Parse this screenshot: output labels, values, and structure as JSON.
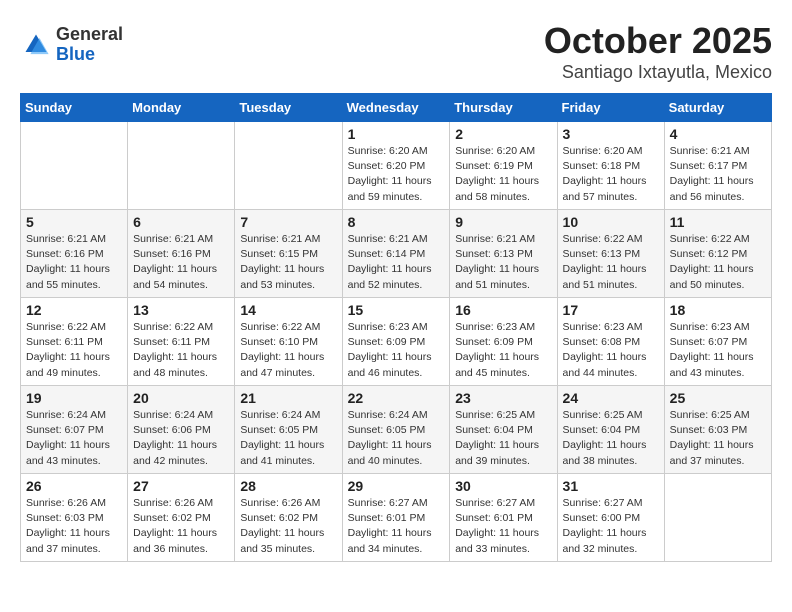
{
  "header": {
    "logo_general": "General",
    "logo_blue": "Blue",
    "month_title": "October 2025",
    "location": "Santiago Ixtayutla, Mexico"
  },
  "days_of_week": [
    "Sunday",
    "Monday",
    "Tuesday",
    "Wednesday",
    "Thursday",
    "Friday",
    "Saturday"
  ],
  "weeks": [
    [
      {
        "day": "",
        "info": ""
      },
      {
        "day": "",
        "info": ""
      },
      {
        "day": "",
        "info": ""
      },
      {
        "day": "1",
        "info": "Sunrise: 6:20 AM\nSunset: 6:20 PM\nDaylight: 11 hours and 59 minutes."
      },
      {
        "day": "2",
        "info": "Sunrise: 6:20 AM\nSunset: 6:19 PM\nDaylight: 11 hours and 58 minutes."
      },
      {
        "day": "3",
        "info": "Sunrise: 6:20 AM\nSunset: 6:18 PM\nDaylight: 11 hours and 57 minutes."
      },
      {
        "day": "4",
        "info": "Sunrise: 6:21 AM\nSunset: 6:17 PM\nDaylight: 11 hours and 56 minutes."
      }
    ],
    [
      {
        "day": "5",
        "info": "Sunrise: 6:21 AM\nSunset: 6:16 PM\nDaylight: 11 hours and 55 minutes."
      },
      {
        "day": "6",
        "info": "Sunrise: 6:21 AM\nSunset: 6:16 PM\nDaylight: 11 hours and 54 minutes."
      },
      {
        "day": "7",
        "info": "Sunrise: 6:21 AM\nSunset: 6:15 PM\nDaylight: 11 hours and 53 minutes."
      },
      {
        "day": "8",
        "info": "Sunrise: 6:21 AM\nSunset: 6:14 PM\nDaylight: 11 hours and 52 minutes."
      },
      {
        "day": "9",
        "info": "Sunrise: 6:21 AM\nSunset: 6:13 PM\nDaylight: 11 hours and 51 minutes."
      },
      {
        "day": "10",
        "info": "Sunrise: 6:22 AM\nSunset: 6:13 PM\nDaylight: 11 hours and 51 minutes."
      },
      {
        "day": "11",
        "info": "Sunrise: 6:22 AM\nSunset: 6:12 PM\nDaylight: 11 hours and 50 minutes."
      }
    ],
    [
      {
        "day": "12",
        "info": "Sunrise: 6:22 AM\nSunset: 6:11 PM\nDaylight: 11 hours and 49 minutes."
      },
      {
        "day": "13",
        "info": "Sunrise: 6:22 AM\nSunset: 6:11 PM\nDaylight: 11 hours and 48 minutes."
      },
      {
        "day": "14",
        "info": "Sunrise: 6:22 AM\nSunset: 6:10 PM\nDaylight: 11 hours and 47 minutes."
      },
      {
        "day": "15",
        "info": "Sunrise: 6:23 AM\nSunset: 6:09 PM\nDaylight: 11 hours and 46 minutes."
      },
      {
        "day": "16",
        "info": "Sunrise: 6:23 AM\nSunset: 6:09 PM\nDaylight: 11 hours and 45 minutes."
      },
      {
        "day": "17",
        "info": "Sunrise: 6:23 AM\nSunset: 6:08 PM\nDaylight: 11 hours and 44 minutes."
      },
      {
        "day": "18",
        "info": "Sunrise: 6:23 AM\nSunset: 6:07 PM\nDaylight: 11 hours and 43 minutes."
      }
    ],
    [
      {
        "day": "19",
        "info": "Sunrise: 6:24 AM\nSunset: 6:07 PM\nDaylight: 11 hours and 43 minutes."
      },
      {
        "day": "20",
        "info": "Sunrise: 6:24 AM\nSunset: 6:06 PM\nDaylight: 11 hours and 42 minutes."
      },
      {
        "day": "21",
        "info": "Sunrise: 6:24 AM\nSunset: 6:05 PM\nDaylight: 11 hours and 41 minutes."
      },
      {
        "day": "22",
        "info": "Sunrise: 6:24 AM\nSunset: 6:05 PM\nDaylight: 11 hours and 40 minutes."
      },
      {
        "day": "23",
        "info": "Sunrise: 6:25 AM\nSunset: 6:04 PM\nDaylight: 11 hours and 39 minutes."
      },
      {
        "day": "24",
        "info": "Sunrise: 6:25 AM\nSunset: 6:04 PM\nDaylight: 11 hours and 38 minutes."
      },
      {
        "day": "25",
        "info": "Sunrise: 6:25 AM\nSunset: 6:03 PM\nDaylight: 11 hours and 37 minutes."
      }
    ],
    [
      {
        "day": "26",
        "info": "Sunrise: 6:26 AM\nSunset: 6:03 PM\nDaylight: 11 hours and 37 minutes."
      },
      {
        "day": "27",
        "info": "Sunrise: 6:26 AM\nSunset: 6:02 PM\nDaylight: 11 hours and 36 minutes."
      },
      {
        "day": "28",
        "info": "Sunrise: 6:26 AM\nSunset: 6:02 PM\nDaylight: 11 hours and 35 minutes."
      },
      {
        "day": "29",
        "info": "Sunrise: 6:27 AM\nSunset: 6:01 PM\nDaylight: 11 hours and 34 minutes."
      },
      {
        "day": "30",
        "info": "Sunrise: 6:27 AM\nSunset: 6:01 PM\nDaylight: 11 hours and 33 minutes."
      },
      {
        "day": "31",
        "info": "Sunrise: 6:27 AM\nSunset: 6:00 PM\nDaylight: 11 hours and 32 minutes."
      },
      {
        "day": "",
        "info": ""
      }
    ]
  ]
}
